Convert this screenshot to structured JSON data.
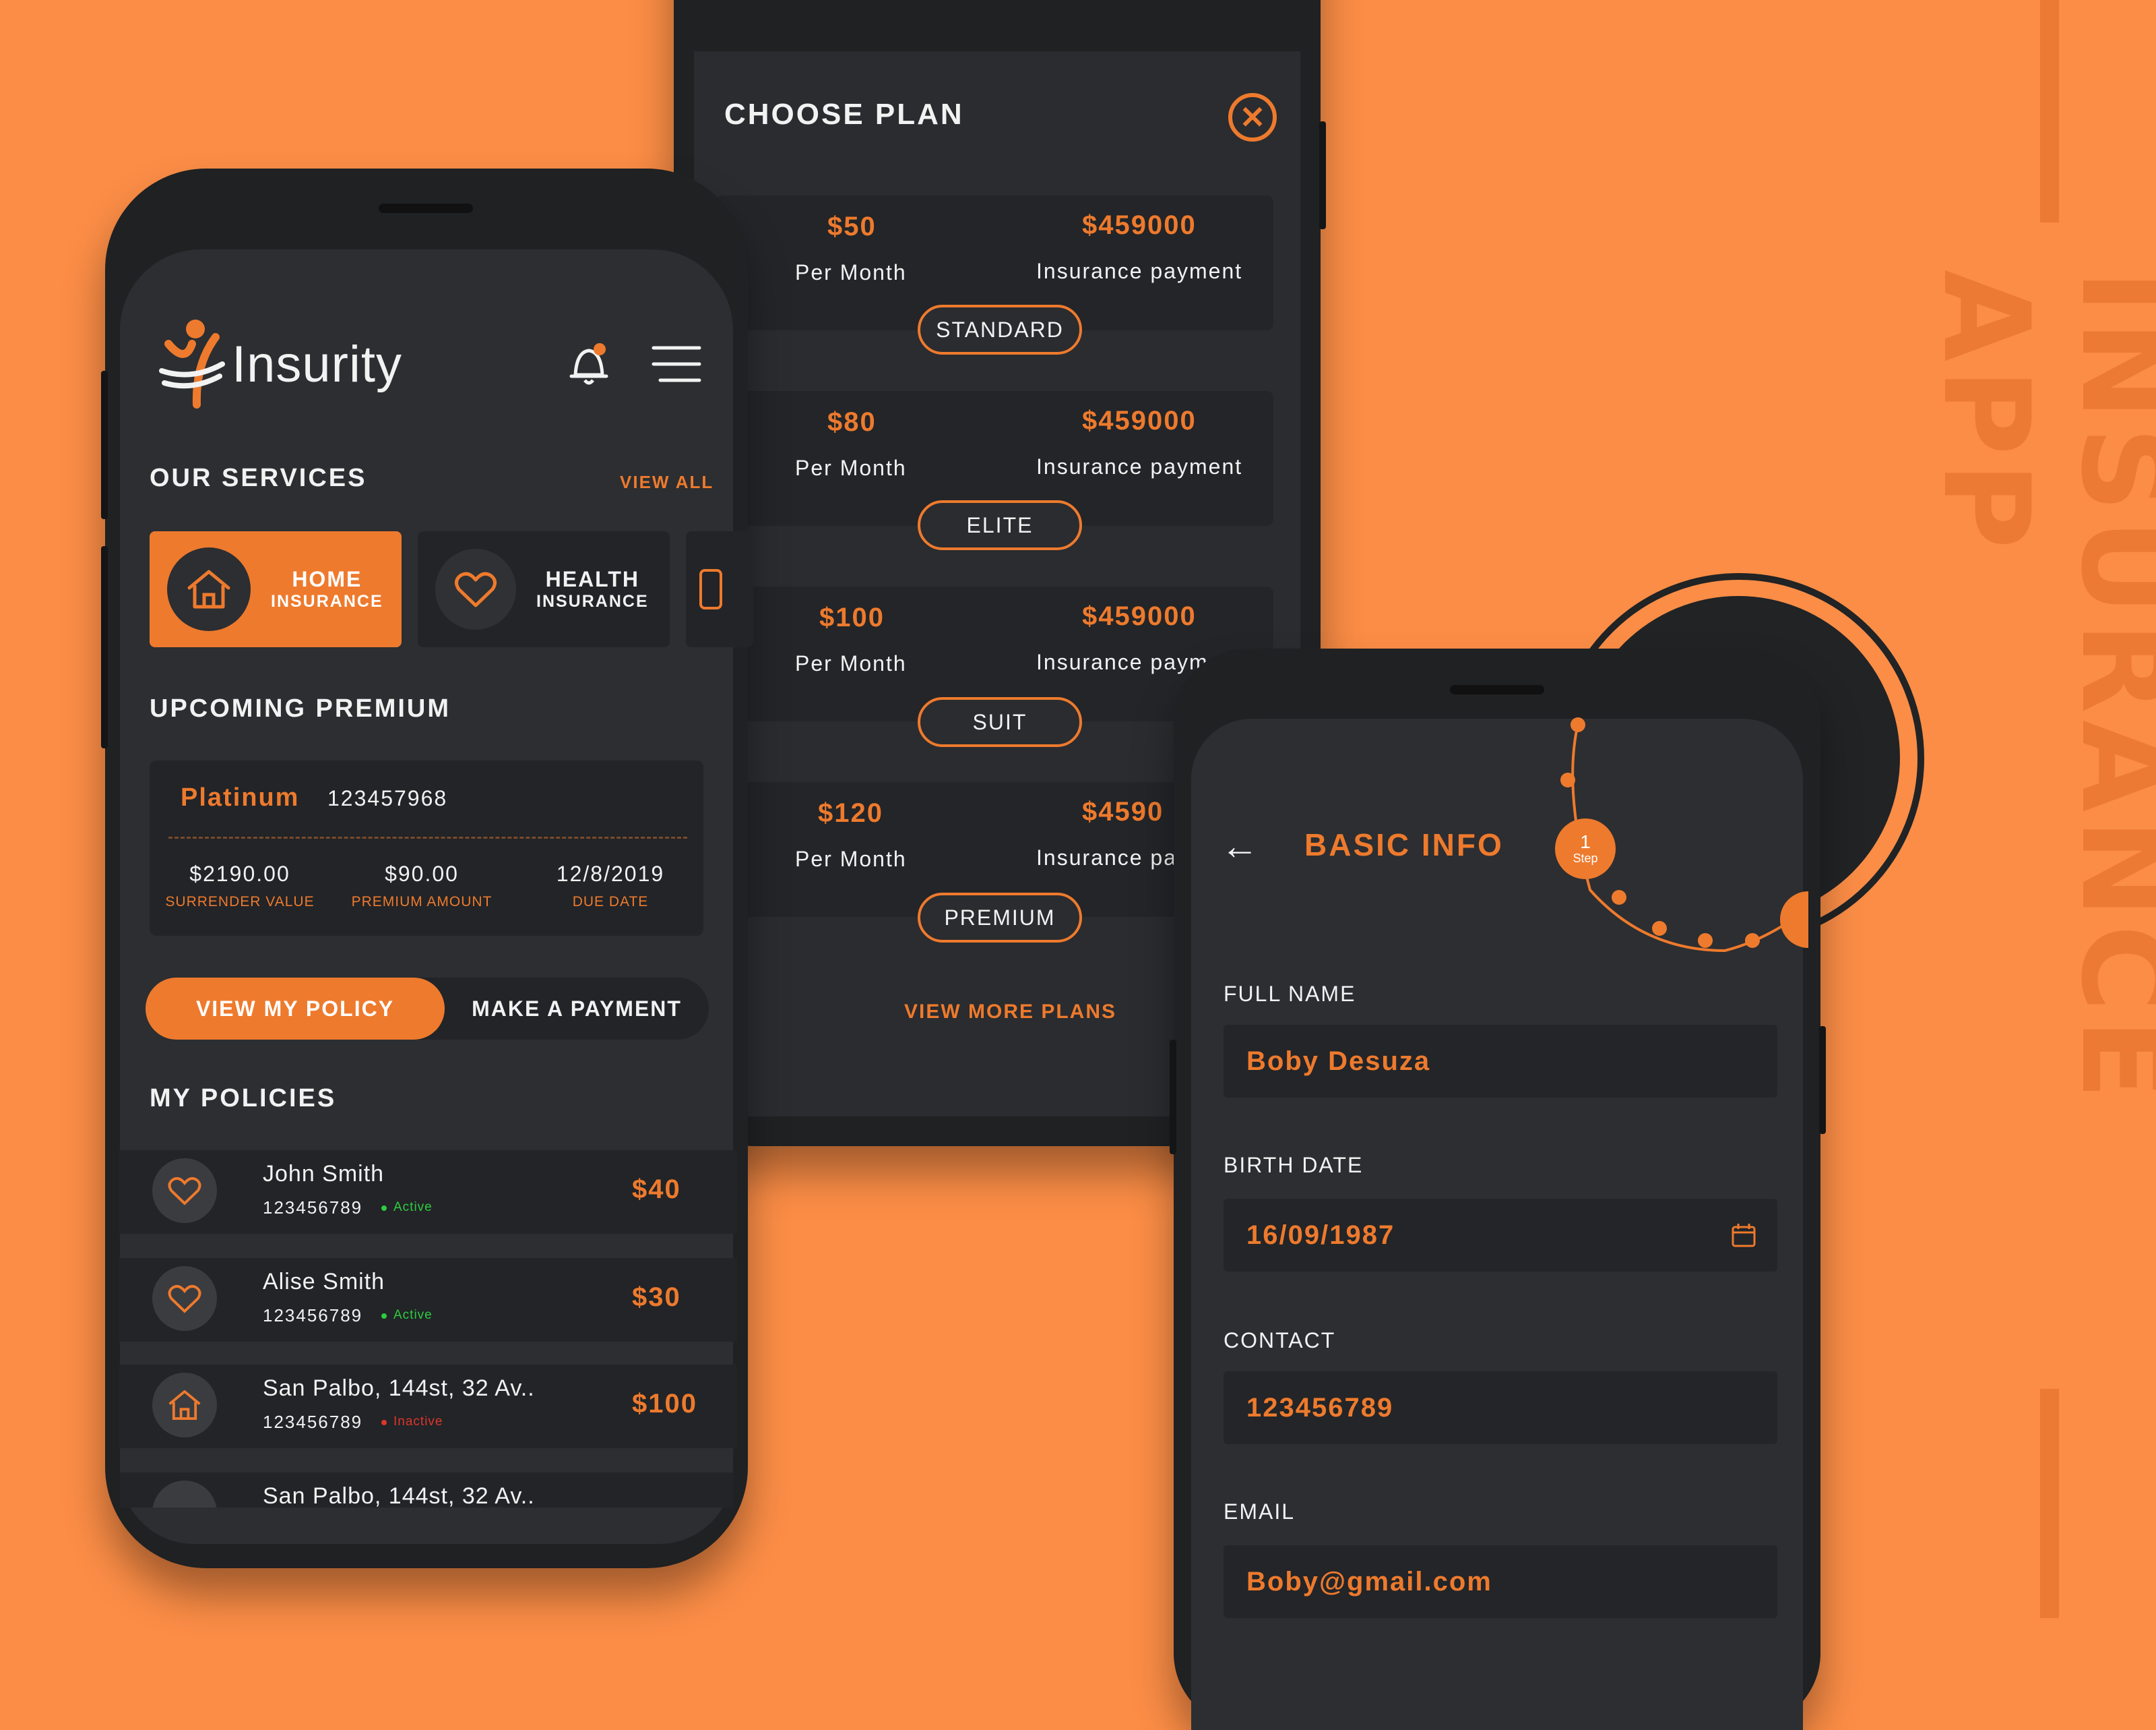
{
  "side_title": "INSURANCE APP",
  "colors": {
    "accent": "#ee7a2d",
    "background": "#fb8d46",
    "panel": "#2c2e31",
    "active": "#2ecc40",
    "inactive": "#e0352b"
  },
  "plan_screen": {
    "title": "CHOOSE PLAN",
    "close_icon": "close-circle-icon",
    "plans": [
      {
        "price": "$50",
        "period": "Per Month",
        "coverage": "$459000",
        "coverage_label": "Insurance payment",
        "name": "STANDARD"
      },
      {
        "price": "$80",
        "period": "Per Month",
        "coverage": "$459000",
        "coverage_label": "Insurance payment",
        "name": "ELITE"
      },
      {
        "price": "$100",
        "period": "Per Month",
        "coverage": "$459000",
        "coverage_label": "Insurance paym",
        "name": "SUIT"
      },
      {
        "price": "$120",
        "period": "Per Month",
        "coverage": "$4590",
        "coverage_label": "Insurance pa",
        "name": "PREMIUM"
      }
    ],
    "view_more": "VIEW MORE PLANS"
  },
  "home_screen": {
    "logo_text": "Insurity",
    "bell_icon": "bell-icon",
    "menu_icon": "hamburger-menu-icon",
    "services_title": "OUR SERVICES",
    "view_all": "VIEW ALL",
    "services": [
      {
        "line1": "HOME",
        "line2": "INSURANCE",
        "icon": "home-icon",
        "active": true
      },
      {
        "line1": "HEALTH",
        "line2": "INSURANCE",
        "icon": "heart-icon",
        "active": false
      }
    ],
    "premium_title": "UPCOMING PREMIUM",
    "premium": {
      "plan": "Platinum",
      "number": "123457968",
      "surrender_value": "$2190.00",
      "surrender_label": "SURRENDER VALUE",
      "premium_amount": "$90.00",
      "premium_label": "PREMIUM AMOUNT",
      "due_date": "12/8/2019",
      "due_label": "DUE DATE"
    },
    "btn_view_policy": "VIEW MY POLICY",
    "btn_make_payment": "MAKE A PAYMENT",
    "policies_title": "MY POLICIES",
    "policies": [
      {
        "name": "John Smith",
        "id": "123456789",
        "status": "Active",
        "amount": "$40",
        "icon": "heart-icon"
      },
      {
        "name": "Alise Smith",
        "id": "123456789",
        "status": "Active",
        "amount": "$30",
        "icon": "heart-icon"
      },
      {
        "name": "San Palbo, 144st, 32 Av..",
        "id": "123456789",
        "status": "Inactive",
        "amount": "$100",
        "icon": "home-icon"
      },
      {
        "name": "San Palbo, 144st, 32 Av..",
        "id": "",
        "status": "",
        "amount": "",
        "icon": "home-icon"
      }
    ]
  },
  "info_screen": {
    "title": "BASIC INFO",
    "back_icon": "arrow-left-icon",
    "step_number": "1",
    "step_label": "Step",
    "fields": [
      {
        "label": "FULL NAME",
        "value": "Boby Desuza"
      },
      {
        "label": "BIRTH DATE",
        "value": "16/09/1987",
        "icon": "calendar-icon"
      },
      {
        "label": "CONTACT",
        "value": "123456789"
      },
      {
        "label": "EMAIL",
        "value": "Boby@gmail.com"
      }
    ]
  }
}
